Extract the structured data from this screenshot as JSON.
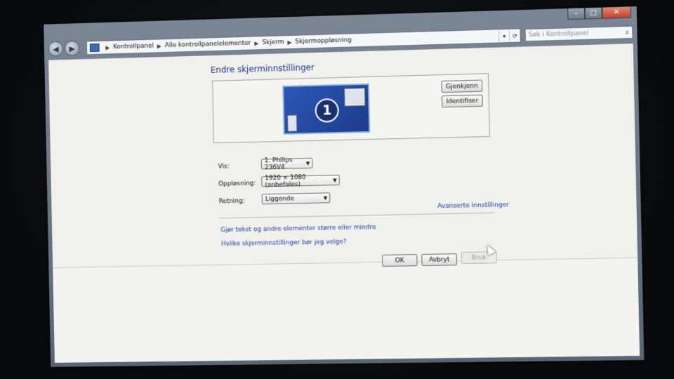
{
  "window": {
    "minimize_icon": "minimize-icon",
    "maximize_icon": "maximize-icon",
    "close_icon": "close-icon"
  },
  "nav": {
    "back_icon": "back-arrow-icon",
    "forward_icon": "forward-arrow-icon",
    "breadcrumb": [
      "Kontrollpanel",
      "Alle kontrollpanelelementer",
      "Skjerm",
      "Skjermoppløsning"
    ],
    "search_placeholder": "Søk i Kontrollpanel"
  },
  "main": {
    "heading": "Endre skjerminnstillinger",
    "monitor_number": "1",
    "detect_button": "Gjenkjenn",
    "identify_button": "Identifiser",
    "fields": {
      "display_label": "Vis:",
      "display_value": "1. Philips 236V4",
      "resolution_label": "Oppløsning:",
      "resolution_value": "1920 × 1080 (anbefales)",
      "orientation_label": "Retning:",
      "orientation_value": "Liggende"
    },
    "advanced_link": "Avanserte innstillinger",
    "links": [
      "Gjør tekst og andre elementer større eller mindre",
      "Hvilke skjerminnstillinger bør jeg velge?"
    ],
    "ok_button": "OK",
    "cancel_button": "Avbryt",
    "apply_button": "Bruk"
  },
  "colors": {
    "link": "#1c3da3",
    "heading": "#1e3287",
    "monitor_fill": "#2c58b6"
  }
}
